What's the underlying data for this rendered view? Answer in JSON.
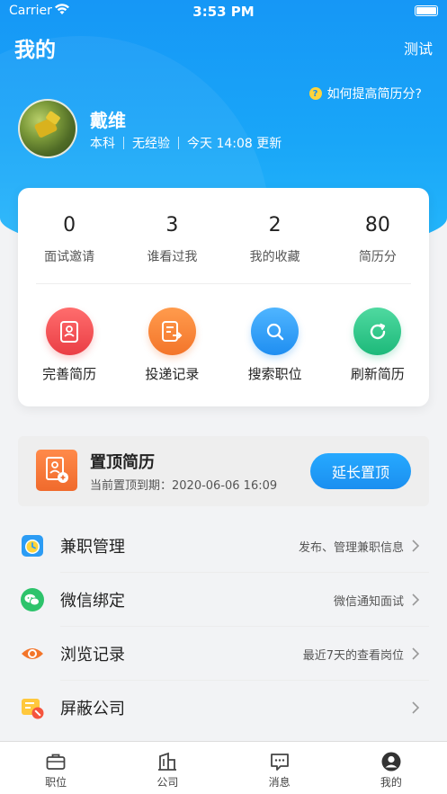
{
  "status_bar": {
    "carrier": "Carrier",
    "time": "3:53 PM"
  },
  "navbar": {
    "title": "我的",
    "right_action": "测试"
  },
  "tip": {
    "text": "如何提高简历分?"
  },
  "profile": {
    "name": "戴维",
    "education": "本科",
    "experience": "无经验",
    "updated": "今天 14:08 更新"
  },
  "stats": [
    {
      "value": "0",
      "label": "面试邀请"
    },
    {
      "value": "3",
      "label": "谁看过我"
    },
    {
      "value": "2",
      "label": "我的收藏"
    },
    {
      "value": "80",
      "label": "简历分"
    }
  ],
  "actions": [
    {
      "label": "完善简历",
      "icon": "resume-edit-icon",
      "color": "#ea3e45"
    },
    {
      "label": "投递记录",
      "icon": "delivery-record-icon",
      "color": "#f3752a"
    },
    {
      "label": "搜索职位",
      "icon": "search-icon",
      "color": "#1f8ef1"
    },
    {
      "label": "刷新简历",
      "icon": "refresh-icon",
      "color": "#1db97a"
    }
  ],
  "pin": {
    "title": "置顶简历",
    "expiry": "当前置顶到期：2020-06-06 16:09",
    "button": "延长置顶"
  },
  "menu": [
    {
      "label": "兼职管理",
      "hint": "发布、管理兼职信息",
      "icon": "alarm-clock-icon"
    },
    {
      "label": "微信绑定",
      "hint": "微信通知面试",
      "icon": "wechat-icon"
    },
    {
      "label": "浏览记录",
      "hint": "最近7天的查看岗位",
      "icon": "eye-icon"
    },
    {
      "label": "屏蔽公司",
      "hint": "",
      "icon": "block-company-icon"
    }
  ],
  "tabs": [
    {
      "label": "职位",
      "icon": "briefcase-icon"
    },
    {
      "label": "公司",
      "icon": "building-icon"
    },
    {
      "label": "消息",
      "icon": "message-icon"
    },
    {
      "label": "我的",
      "icon": "user-icon"
    }
  ],
  "colors": {
    "primary": "#1b8ff0",
    "accent_yellow": "#ffd43b"
  }
}
